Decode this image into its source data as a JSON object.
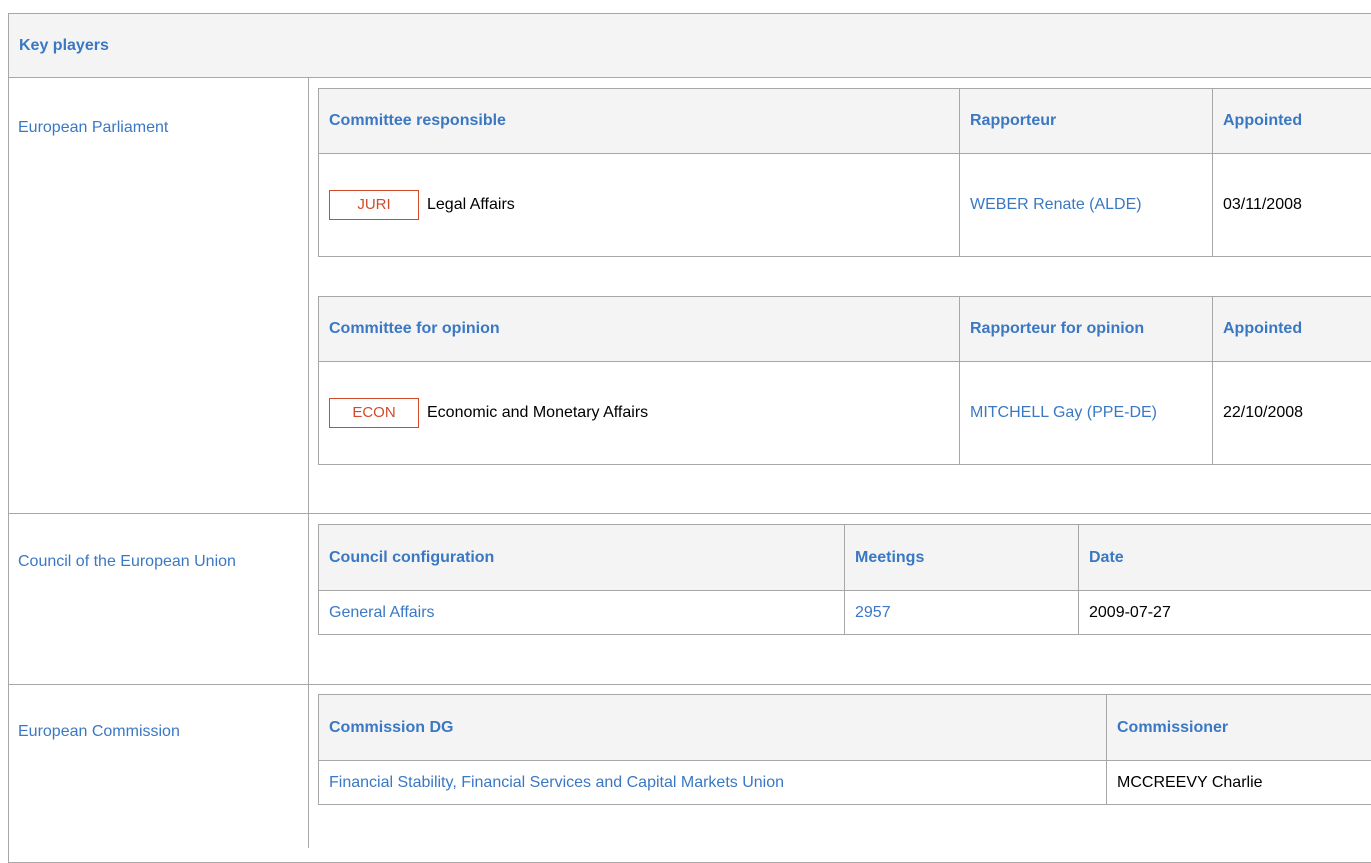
{
  "section": {
    "title": "Key players"
  },
  "parliament": {
    "label": "European Parliament",
    "responsible": {
      "headers": [
        "Committee responsible",
        "Rapporteur",
        "Appointed"
      ],
      "rows": [
        {
          "code": "JURI",
          "name": "Legal Affairs",
          "rapporteur": "WEBER Renate (ALDE)",
          "appointed": "03/11/2008"
        }
      ]
    },
    "opinion": {
      "headers": [
        "Committee for opinion",
        "Rapporteur for opinion",
        "Appointed"
      ],
      "rows": [
        {
          "code": "ECON",
          "name": "Economic and Monetary Affairs",
          "rapporteur": "MITCHELL Gay (PPE-DE)",
          "appointed": "22/10/2008"
        }
      ]
    }
  },
  "council": {
    "label": "Council of the European Union",
    "headers": [
      "Council configuration",
      "Meetings",
      "Date"
    ],
    "rows": [
      {
        "configuration": "General Affairs",
        "meeting": "2957",
        "date": "2009-07-27"
      }
    ]
  },
  "commission": {
    "label": "European Commission",
    "headers": [
      "Commission DG",
      "Commissioner"
    ],
    "rows": [
      {
        "dg": "Financial Stability, Financial Services and Capital Markets Union",
        "commissioner": "MCCREEVY Charlie"
      }
    ]
  },
  "colors": {
    "link": "#3a78c4",
    "badge": "#d34a2a",
    "header_bg": "#f4f4f4",
    "border": "#a7a7a7"
  }
}
